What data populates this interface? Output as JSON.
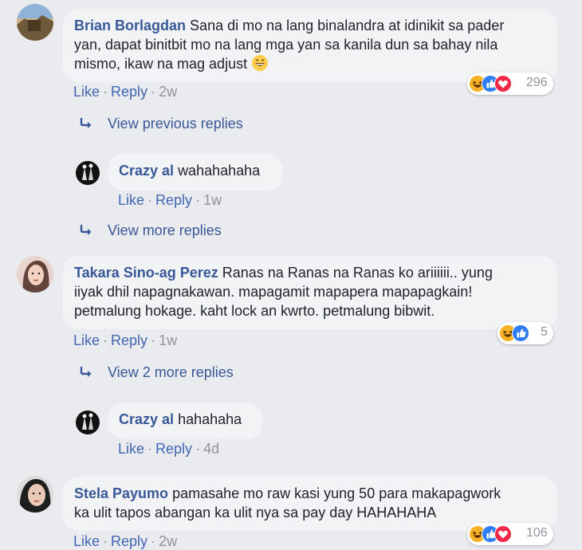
{
  "comments": [
    {
      "name": "Brian Borlagdan",
      "text_1": "Sana di mo na lang binalandra at idinikit sa pader",
      "text_2": "yan, dapat binitbit mo na lang mga yan sa kanila dun sa bahay nila",
      "text_3": "mismo, ikaw na mag adjust",
      "emoji": "grinning-face-emoji",
      "like": "Like",
      "reply": "Reply",
      "time": "2w",
      "reaction_count": "296",
      "reactions": [
        "haha-icon",
        "like-icon",
        "love-icon"
      ]
    },
    {
      "name": "Takara Sino-ag Perez",
      "text_1": "Ranas na Ranas na Ranas ko ariiiiii.. yung",
      "text_2": "iiyak dhil napagnakawan. mapagamit mapapera mapapagkain!",
      "text_3": "petmalung hokage. kaht lock an kwrto. petmalung bibwit.",
      "like": "Like",
      "reply": "Reply",
      "time": "1w",
      "reaction_count": "5",
      "reactions": [
        "haha-icon",
        "like-icon"
      ]
    },
    {
      "name": "Stela Payumo",
      "text_1": "pamasahe mo raw kasi yung 50 para makapagwork",
      "text_2": "ka ulit tapos abangan ka ulit nya sa pay day HAHAHAHA",
      "like": "Like",
      "reply": "Reply",
      "time": "2w",
      "reaction_count": "106",
      "reactions": [
        "haha-icon",
        "like-icon",
        "love-icon"
      ]
    }
  ],
  "replies": [
    {
      "name": "Crazy al",
      "text": "wahahahaha",
      "like": "Like",
      "reply": "Reply",
      "time": "1w"
    },
    {
      "name": "Crazy al",
      "text": "hahahaha",
      "like": "Like",
      "reply": "Reply",
      "time": "4d"
    }
  ],
  "more_links": {
    "view_previous": "View previous replies",
    "view_more": "View more replies",
    "view_two_more": "View 2 more replies"
  },
  "icons": {
    "reply_arrow": "reply-arrow-icon"
  },
  "colors": {
    "background": "#e9ebee",
    "bubble": "#f2f3f5",
    "name": "#385898",
    "link": "#4267b2",
    "muted": "#90949c",
    "haha": "#f7b125",
    "like": "#2e7cf6",
    "love": "#f0284a"
  }
}
